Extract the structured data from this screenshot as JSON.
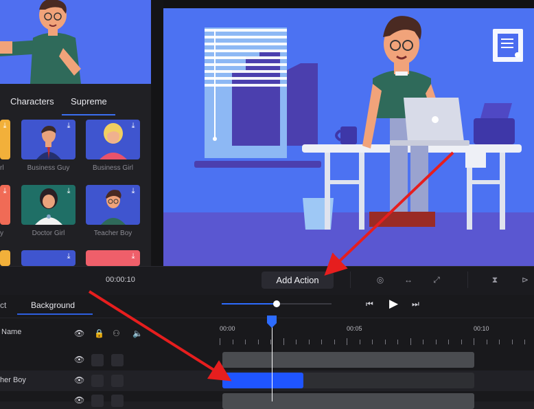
{
  "library": {
    "tabs": [
      {
        "label": "Characters"
      },
      {
        "label": "Supreme"
      }
    ],
    "cards": [
      {
        "label": "Business Guy",
        "bg": "#3f55cf"
      },
      {
        "label": "Business Girl",
        "bg": "#3f55cf"
      },
      {
        "label": "Doctor Girl",
        "bg": "#1f6f66"
      },
      {
        "label": "Teacher Boy",
        "bg": "#3f55cf"
      }
    ],
    "partial_left_labels": [
      "rl",
      "y"
    ]
  },
  "toolbar": {
    "timecode": "00:00:10",
    "add_action_label": "Add Action"
  },
  "timeline": {
    "tabs": [
      {
        "label": "ct"
      },
      {
        "label": "Background"
      }
    ],
    "header_name": "Name",
    "ruler_labels": [
      "00:00",
      "00:05",
      "00:10"
    ],
    "rows": [
      {
        "label": ""
      },
      {
        "label": "her Boy"
      },
      {
        "label": ""
      }
    ]
  },
  "colors": {
    "accent": "#1f55ff",
    "canvas_bg": "#4c72f2",
    "arrow": "#e61e1e"
  }
}
